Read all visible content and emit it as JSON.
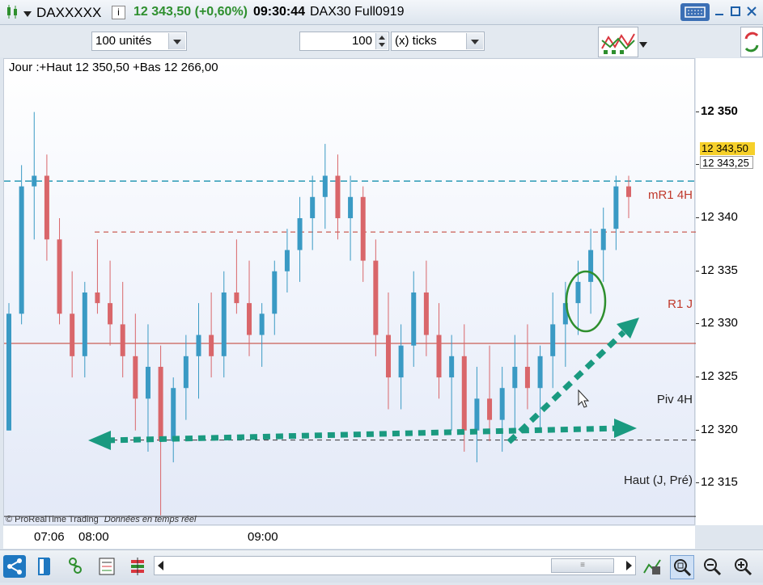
{
  "titlebar": {
    "symbol": "DAXXXXX",
    "info_icon": "i",
    "price": "12 343,50 (+0,60%)",
    "time": "09:30:44",
    "contract": "DAX30 Full0919"
  },
  "toolbar": {
    "units_select": "100 unités",
    "ticks_value": "100",
    "ticks_unit": "(x) ticks"
  },
  "chart": {
    "header": "Jour :+Haut 12 350,50 +Bas 12 266,00",
    "copyright": "© ProRealTime Trading",
    "realtime": "Données en temps réel",
    "lines": {
      "mr1": "mR1 4H",
      "r1j": "R1 J",
      "piv": "Piv 4H",
      "haut": "Haut (J, Pré)"
    },
    "price_tags": {
      "last": "12 343,50",
      "bid": "12 343,25"
    },
    "y_ticks": [
      "12 350",
      "12 345",
      "12 340",
      "12 335",
      "12 330",
      "12 325",
      "12 320",
      "12 315"
    ],
    "x_ticks": [
      "07:06",
      "08:00",
      "09:00"
    ]
  },
  "chart_data": {
    "type": "candlestick",
    "ylim": [
      12311,
      12355
    ],
    "y_ticks": [
      12350,
      12345,
      12340,
      12335,
      12330,
      12325,
      12320,
      12315
    ],
    "levels": [
      {
        "name": "mR1 4H",
        "value": 12338.7,
        "color": "#c0392b",
        "style": "dashed"
      },
      {
        "name": "R1 J",
        "value": 12328.2,
        "color": "#c0392b",
        "style": "solid"
      },
      {
        "name": "Piv 4H",
        "value": 12319.1,
        "color": "#333333",
        "style": "dashed"
      },
      {
        "name": "Haut (J, Pré)",
        "value": 12311.9,
        "color": "#333333",
        "style": "solid"
      },
      {
        "name": "last",
        "value": 12343.5,
        "color": "#2a9bb5",
        "style": "dashed"
      }
    ],
    "candles": [
      [
        12320,
        12332,
        12320,
        12331
      ],
      [
        12331,
        12345,
        12330,
        12343
      ],
      [
        12343,
        12350,
        12338,
        12344
      ],
      [
        12344,
        12346,
        12336,
        12338
      ],
      [
        12338,
        12340,
        12330,
        12331
      ],
      [
        12331,
        12335,
        12325,
        12327
      ],
      [
        12327,
        12334,
        12325,
        12333
      ],
      [
        12333,
        12338,
        12331,
        12332
      ],
      [
        12332,
        12336,
        12328,
        12330
      ],
      [
        12330,
        12334,
        12325,
        12327
      ],
      [
        12327,
        12331,
        12320,
        12323
      ],
      [
        12323,
        12330,
        12318,
        12326
      ],
      [
        12326,
        12328,
        12312,
        12319
      ],
      [
        12319,
        12325,
        12317,
        12324
      ],
      [
        12324,
        12329,
        12321,
        12327
      ],
      [
        12327,
        12332,
        12323,
        12329
      ],
      [
        12329,
        12333,
        12325,
        12327
      ],
      [
        12327,
        12335,
        12325,
        12333
      ],
      [
        12333,
        12338,
        12331,
        12332
      ],
      [
        12332,
        12336,
        12327,
        12329
      ],
      [
        12329,
        12332,
        12326,
        12331
      ],
      [
        12331,
        12336,
        12329,
        12335
      ],
      [
        12335,
        12339,
        12333,
        12337
      ],
      [
        12337,
        12342,
        12334,
        12340
      ],
      [
        12340,
        12344,
        12337,
        12342
      ],
      [
        12342,
        12347,
        12339,
        12344
      ],
      [
        12344,
        12346,
        12338,
        12340
      ],
      [
        12340,
        12344,
        12336,
        12342
      ],
      [
        12342,
        12343,
        12334,
        12336
      ],
      [
        12336,
        12338,
        12327,
        12329
      ],
      [
        12329,
        12333,
        12322,
        12325
      ],
      [
        12325,
        12330,
        12322,
        12328
      ],
      [
        12328,
        12335,
        12326,
        12333
      ],
      [
        12333,
        12336,
        12327,
        12329
      ],
      [
        12329,
        12332,
        12323,
        12325
      ],
      [
        12325,
        12329,
        12320,
        12327
      ],
      [
        12327,
        12330,
        12318,
        12320
      ],
      [
        12320,
        12326,
        12317,
        12323
      ],
      [
        12323,
        12328,
        12319,
        12321
      ],
      [
        12321,
        12326,
        12318,
        12324
      ],
      [
        12324,
        12329,
        12320,
        12326
      ],
      [
        12326,
        12330,
        12322,
        12324
      ],
      [
        12324,
        12328,
        12320,
        12327
      ],
      [
        12327,
        12333,
        12324,
        12330
      ],
      [
        12330,
        12334,
        12326,
        12332
      ],
      [
        12332,
        12336,
        12329,
        12334
      ],
      [
        12334,
        12339,
        12331,
        12337
      ],
      [
        12337,
        12341,
        12334,
        12339
      ],
      [
        12339,
        12344,
        12337,
        12343
      ],
      [
        12343,
        12344,
        12340,
        12342
      ]
    ]
  },
  "bottombar": {
    "icons": [
      "share-icon",
      "layout-icon",
      "indicators-icon",
      "list-icon",
      "studies-icon"
    ],
    "right_icons": [
      "drawing-tools-icon",
      "zoom-select-icon",
      "zoom-out-icon",
      "zoom-in-icon"
    ]
  },
  "colors": {
    "up": "#3a9ac4",
    "down": "#d9666a",
    "arrow": "#1a9a80",
    "circle": "#2e8f2e"
  }
}
